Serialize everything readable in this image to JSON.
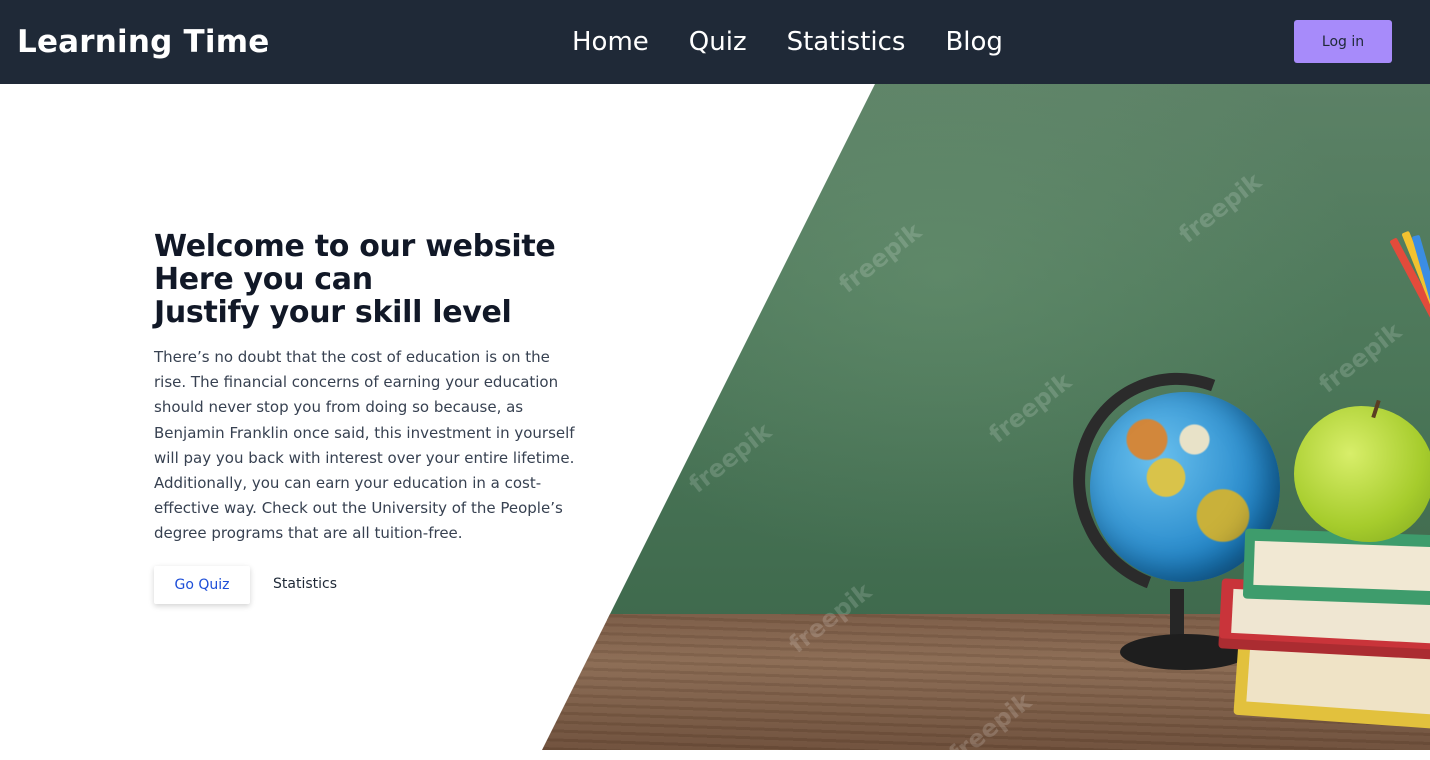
{
  "brand": {
    "name": "Learning Time"
  },
  "nav": {
    "items": [
      {
        "label": "Home"
      },
      {
        "label": "Quiz"
      },
      {
        "label": "Statistics"
      },
      {
        "label": "Blog"
      }
    ],
    "login_label": "Log in"
  },
  "hero": {
    "title_lines": [
      "Welcome to our website",
      "Here you can",
      "Justify your skill level"
    ],
    "description": "There’s no doubt that the cost of education is on the rise. The financial concerns of earning your education should never stop you from doing so because, as Benjamin Franklin once said, this investment in yourself will pay you back with interest over your entire lifetime. Additionally, you can earn your education in a cost-effective way. Check out the University of the People’s degree programs that are all tuition-free.",
    "primary_button": "Go Quiz",
    "secondary_link": "Statistics",
    "image_watermark": "freepik"
  },
  "colors": {
    "navbar_bg": "#1f2937",
    "login_bg": "#a78bfa",
    "primary_button_text": "#1d4ed8"
  }
}
